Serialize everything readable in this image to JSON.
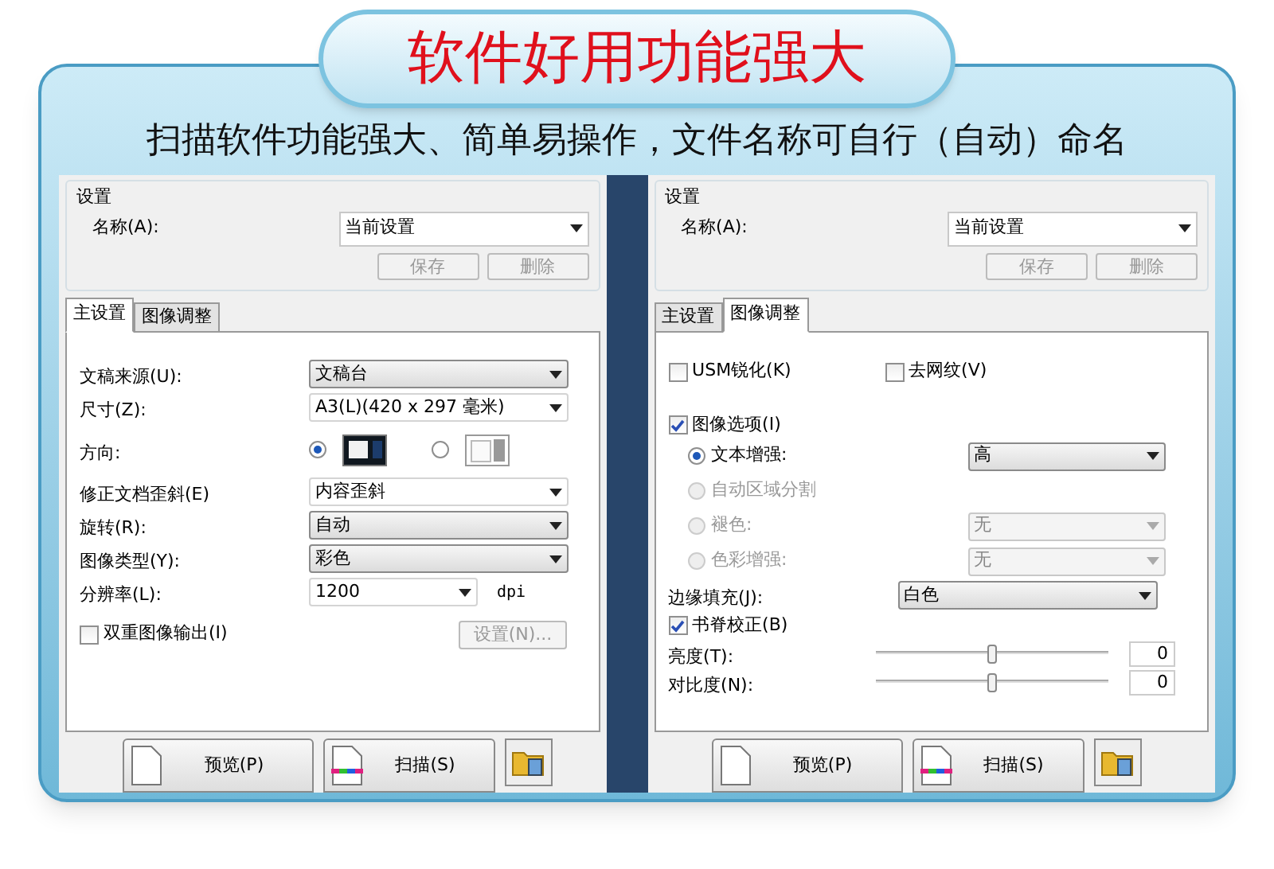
{
  "banner": {
    "title": "软件好用功能强大"
  },
  "subtitle": "扫描软件功能强大、简单易操作，文件名称可自行（自动）命名",
  "panels": [
    {
      "settings": {
        "group_label": "设置",
        "name_label": "名称(A):",
        "name_value": "当前设置",
        "buttons": [
          {
            "label": "保存",
            "disabled": true
          },
          {
            "label": "删除",
            "disabled": true
          }
        ]
      },
      "tabs": [
        {
          "label": "主设置",
          "selected": true
        },
        {
          "label": "图像调整",
          "selected": false
        }
      ],
      "rows": [
        {
          "kind": "select",
          "label": "文稿来源(U):",
          "value": "文稿台",
          "editable": false
        },
        {
          "kind": "select",
          "label": "尺寸(Z):",
          "value": "A3(L)(420 x 297 毫米)",
          "editable": true
        },
        {
          "kind": "orientation",
          "label": "方向:",
          "options": [
            {
              "selected": true
            },
            {
              "selected": false
            }
          ]
        },
        {
          "kind": "select",
          "label": "修正文档歪斜(E)",
          "value": "内容歪斜",
          "editable": true
        },
        {
          "kind": "select",
          "label": "旋转(R):",
          "value": "自动",
          "editable": false
        },
        {
          "kind": "select",
          "label": "图像类型(Y):",
          "value": "彩色",
          "editable": false
        },
        {
          "kind": "select",
          "label": "分辨率(L):",
          "value": "1200",
          "editable": true,
          "unit": "dpi"
        },
        {
          "kind": "checkbox",
          "label": "双重图像输出(I)",
          "checked": false,
          "button": {
            "label": "设置(N)...",
            "disabled": true
          }
        }
      ],
      "footer_buttons": [
        {
          "label": "预览(P)",
          "kind": "preview"
        },
        {
          "label": "扫描(S)",
          "kind": "scan"
        }
      ]
    },
    {
      "settings": {
        "group_label": "设置",
        "name_label": "名称(A):",
        "name_value": "当前设置",
        "buttons": [
          {
            "label": "保存",
            "disabled": true
          },
          {
            "label": "删除",
            "disabled": true
          }
        ]
      },
      "tabs": [
        {
          "label": "主设置",
          "selected": false
        },
        {
          "label": "图像调整",
          "selected": true
        }
      ],
      "rows": [
        {
          "kind": "checkbox_pair",
          "items": [
            {
              "label": "USM锐化(K)",
              "checked": false
            },
            {
              "label": "去网纹(V)",
              "checked": false
            }
          ]
        },
        {
          "kind": "checkbox",
          "label": "图像选项(I)",
          "checked": true
        },
        {
          "kind": "radio",
          "label": "文本增强:",
          "selected": true,
          "disabled": false,
          "value": "高"
        },
        {
          "kind": "radio",
          "label": "自动区域分割",
          "selected": false,
          "disabled": true
        },
        {
          "kind": "radio",
          "label": "褪色:",
          "selected": false,
          "disabled": true,
          "value": "无"
        },
        {
          "kind": "radio",
          "label": "色彩增强:",
          "selected": false,
          "disabled": true,
          "value": "无"
        },
        {
          "kind": "select",
          "label": "边缘填充(J):",
          "value": "白色",
          "editable": false
        },
        {
          "kind": "checkbox",
          "label": "书脊校正(B)",
          "checked": true
        },
        {
          "kind": "slider",
          "label": "亮度(T):",
          "level": 0.5,
          "value": "0"
        },
        {
          "kind": "slider",
          "label": "对比度(N):",
          "level": 0.5,
          "value": "0"
        }
      ],
      "footer_buttons": [
        {
          "label": "预览(P)",
          "kind": "preview"
        },
        {
          "label": "扫描(S)",
          "kind": "scan"
        }
      ]
    }
  ]
}
